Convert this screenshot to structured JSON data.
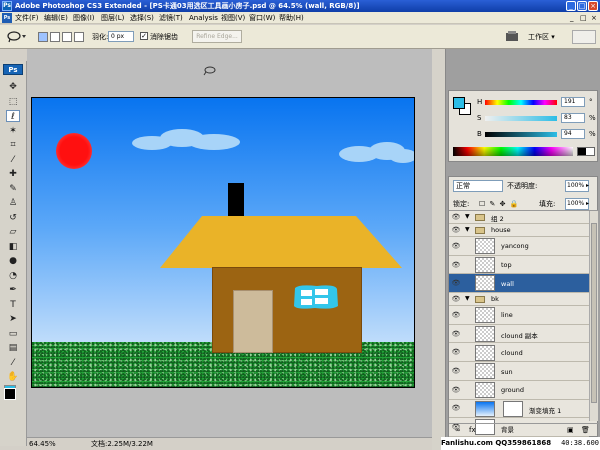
{
  "window": {
    "app_badge": "Ps",
    "title": "Adobe Photoshop CS3 Extended - [PS卡通03用选区工具画小房子.psd @ 64.5% (wall, RGB/8)]",
    "minimize": "_",
    "maximize": "□",
    "close": "×"
  },
  "menu": {
    "badge": "Ps",
    "items": [
      "文件(F)",
      "编辑(E)",
      "图像(I)",
      "图层(L)",
      "选择(S)",
      "滤镜(T)",
      "Analysis",
      "视图(V)",
      "窗口(W)",
      "帮助(H)"
    ],
    "doc_controls": [
      "_",
      "□",
      "×"
    ]
  },
  "options": {
    "tool_icon": "lasso-icon",
    "feather_label": "羽化:",
    "feather_value": "0 px",
    "antialias_checked": "✓",
    "antialias_label": "消除锯齿",
    "refine_edge": "Refine Edge...",
    "workspace": "工作区 ▾"
  },
  "toolbox": {
    "logo": "Ps",
    "tools": [
      {
        "name": "move-tool-icon",
        "glyph": "✥"
      },
      {
        "name": "marquee-tool-icon",
        "glyph": "⬚"
      },
      {
        "name": "lasso-tool-icon",
        "glyph": "ℓ",
        "active": true
      },
      {
        "name": "magic-wand-tool-icon",
        "glyph": "✶"
      },
      {
        "name": "crop-tool-icon",
        "glyph": "⌗"
      },
      {
        "name": "slice-tool-icon",
        "glyph": "⁄"
      },
      {
        "name": "healing-brush-tool-icon",
        "glyph": "✚"
      },
      {
        "name": "brush-tool-icon",
        "glyph": "✎"
      },
      {
        "name": "clone-stamp-tool-icon",
        "glyph": "♙"
      },
      {
        "name": "history-brush-tool-icon",
        "glyph": "↺"
      },
      {
        "name": "eraser-tool-icon",
        "glyph": "▱"
      },
      {
        "name": "paint-bucket-tool-icon",
        "glyph": "◧"
      },
      {
        "name": "blur-tool-icon",
        "glyph": "●"
      },
      {
        "name": "dodge-tool-icon",
        "glyph": "◔"
      },
      {
        "name": "pen-tool-icon",
        "glyph": "✒"
      },
      {
        "name": "type-tool-icon",
        "glyph": "T"
      },
      {
        "name": "path-selection-tool-icon",
        "glyph": "➤"
      },
      {
        "name": "shape-tool-icon",
        "glyph": "▭"
      },
      {
        "name": "notes-tool-icon",
        "glyph": "▤"
      },
      {
        "name": "eyedropper-tool-icon",
        "glyph": "⁄"
      },
      {
        "name": "hand-tool-icon",
        "glyph": "✋"
      },
      {
        "name": "zoom-tool-icon",
        "glyph": "⚲"
      }
    ],
    "foreground_color": "#000000",
    "background_color": "#2cbde6"
  },
  "status": {
    "zoom": "64.45%",
    "docsize": "文档:2.25M/3.22M"
  },
  "color_panel": {
    "fg_color": "#2cbde6",
    "rows": [
      {
        "label": "H",
        "value": "191",
        "unit": "°"
      },
      {
        "label": "S",
        "value": "83",
        "unit": "%"
      },
      {
        "label": "B",
        "value": "94",
        "unit": "%"
      }
    ]
  },
  "layers": {
    "blend_mode": "正常",
    "opacity_label": "不透明度:",
    "opacity_value": "100% ▸",
    "lock_label": "锁定:",
    "fill_label": "填充:",
    "fill_value": "100% ▸",
    "rows": [
      {
        "name": "组 2",
        "kind": "group",
        "indent": 0
      },
      {
        "name": "house",
        "kind": "group",
        "indent": 0
      },
      {
        "name": "yancong",
        "kind": "layer",
        "indent": 1
      },
      {
        "name": "top",
        "kind": "layer",
        "indent": 1
      },
      {
        "name": "wall",
        "kind": "layer",
        "indent": 1,
        "selected": true
      },
      {
        "name": "bk",
        "kind": "group",
        "indent": 0
      },
      {
        "name": "line",
        "kind": "layer",
        "indent": 1
      },
      {
        "name": "clound 副本",
        "kind": "layer",
        "indent": 1
      },
      {
        "name": "clound",
        "kind": "layer",
        "indent": 1
      },
      {
        "name": "sun",
        "kind": "layer",
        "indent": 1
      },
      {
        "name": "ground",
        "kind": "layer",
        "indent": 1
      },
      {
        "name": "渐变填充 1",
        "kind": "fill",
        "indent": 1
      },
      {
        "name": "背景",
        "kind": "background",
        "indent": 0
      }
    ]
  },
  "watermark": {
    "site": "Fanlishu.com QQ359861868",
    "coords": "40:38.600"
  },
  "colors": {
    "sky_top": "#0874f0",
    "sun": "#ff1010",
    "roof": "#eab328",
    "wall": "#9c6412",
    "door": "#cdbb9b",
    "window": "#33c6ea",
    "grass": "#22a438"
  }
}
